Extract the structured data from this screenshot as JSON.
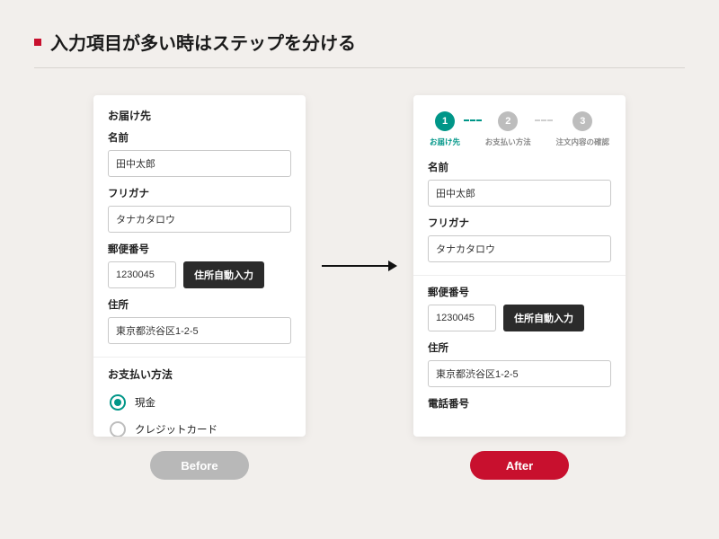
{
  "title": "入力項目が多い時はステップを分ける",
  "badges": {
    "before": "Before",
    "after": "After"
  },
  "before": {
    "delivery_heading": "お届け先",
    "name_label": "名前",
    "name_value": "田中太郎",
    "furigana_label": "フリガナ",
    "furigana_value": "タナカタロウ",
    "postal_label": "郵便番号",
    "postal_value": "1230045",
    "autofill_button": "住所自動入力",
    "address_label": "住所",
    "address_value": "東京都渋谷区1-2-5",
    "payment_heading": "お支払い方法",
    "radio_cash": "現金",
    "radio_credit": "クレジットカード"
  },
  "after": {
    "steps": [
      {
        "num": "1",
        "label": "お届け先",
        "active": true
      },
      {
        "num": "2",
        "label": "お支払い方法",
        "active": false
      },
      {
        "num": "3",
        "label": "注文内容の確認",
        "active": false
      }
    ],
    "name_label": "名前",
    "name_value": "田中太郎",
    "furigana_label": "フリガナ",
    "furigana_value": "タナカタロウ",
    "postal_label": "郵便番号",
    "postal_value": "1230045",
    "autofill_button": "住所自動入力",
    "address_label": "住所",
    "address_value": "東京都渋谷区1-2-5",
    "phone_label": "電話番号"
  },
  "colors": {
    "accent_red": "#c8102e",
    "accent_teal": "#009688",
    "badge_grey": "#b8b8b8"
  }
}
